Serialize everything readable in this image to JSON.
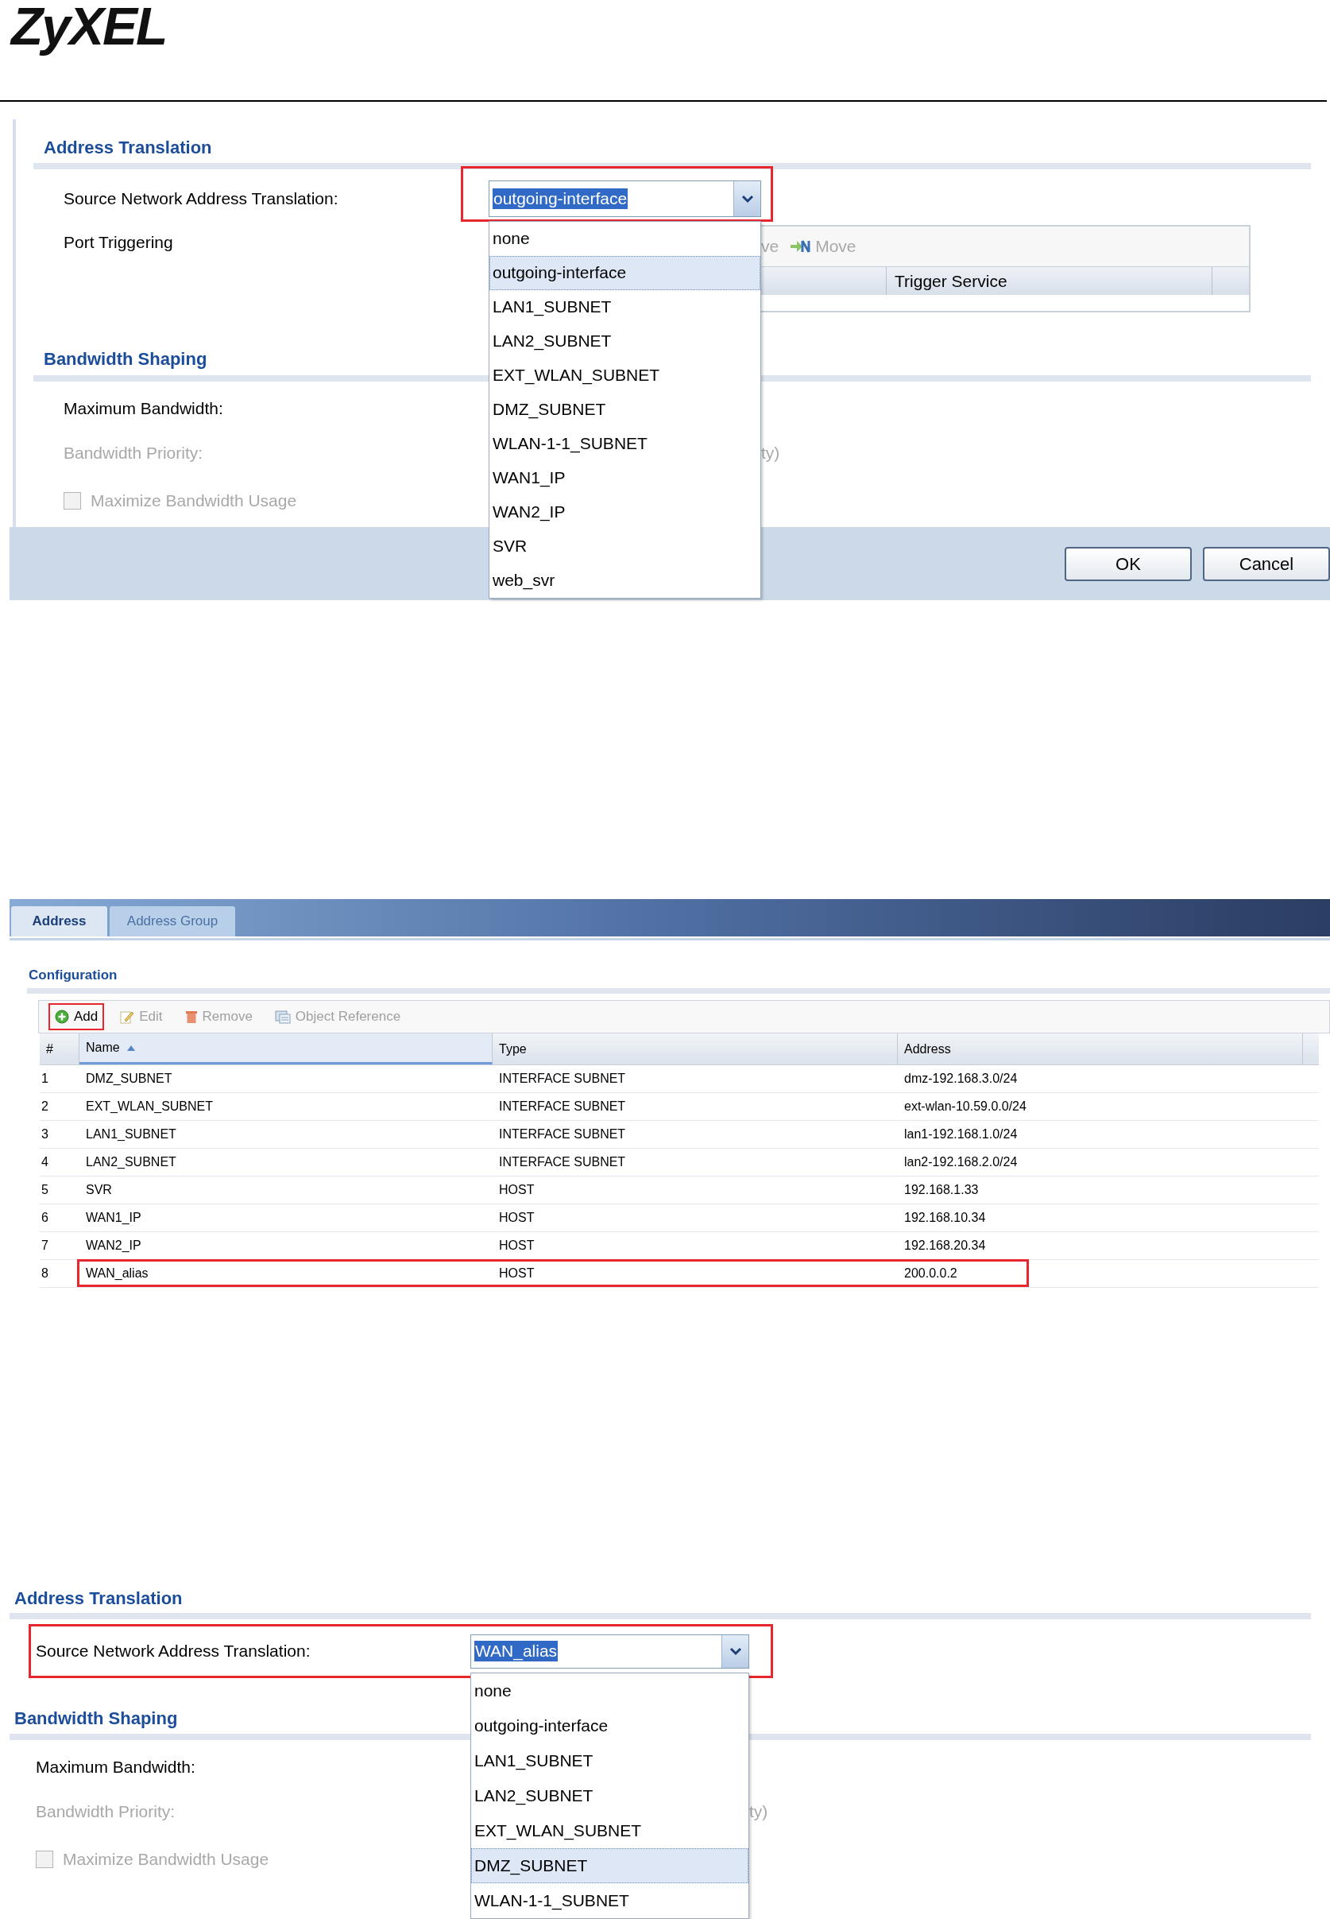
{
  "logo": {
    "text": "ZyXEL"
  },
  "panel_1": {
    "address_translation": {
      "title": "Address Translation",
      "snat_label": "Source Network Address Translation:",
      "snat_value": "outgoing-interface",
      "highlighted": true,
      "options": [
        {
          "label": "none",
          "selected": false
        },
        {
          "label": "outgoing-interface",
          "selected": true
        },
        {
          "label": "LAN1_SUBNET",
          "selected": false
        },
        {
          "label": "LAN2_SUBNET",
          "selected": false
        },
        {
          "label": "EXT_WLAN_SUBNET",
          "selected": false
        },
        {
          "label": "DMZ_SUBNET",
          "selected": false
        },
        {
          "label": "WLAN-1-1_SUBNET",
          "selected": false
        },
        {
          "label": "WAN1_IP",
          "selected": false
        },
        {
          "label": "WAN2_IP",
          "selected": false
        },
        {
          "label": "SVR",
          "selected": false
        },
        {
          "label": "web_svr",
          "selected": false
        }
      ]
    },
    "port_triggering": {
      "label": "Port Triggering",
      "toolbar_text": "ve",
      "move_button": "Move",
      "column": "Trigger Service"
    },
    "bandwidth_shaping": {
      "title": "Bandwidth Shaping",
      "maximum_bandwidth": "Maximum Bandwidth:",
      "bandwidth_priority": {
        "label": "Bandwidth Priority:",
        "disabled": true
      },
      "priority_tail": "ty)",
      "maximize": {
        "label": "Maximize Bandwidth Usage",
        "checked": false,
        "disabled": true
      }
    },
    "buttons": [
      "OK",
      "Cancel"
    ]
  },
  "address_panel": {
    "tabs": [
      {
        "label": "Address",
        "selected": true
      },
      {
        "label": "Address Group",
        "selected": false
      }
    ],
    "section_title": "Configuration",
    "toolbar": [
      {
        "kind": "add",
        "label": "Add",
        "disabled": false,
        "highlighted": true
      },
      {
        "kind": "edit",
        "label": "Edit",
        "disabled": true,
        "highlighted": false
      },
      {
        "kind": "remove",
        "label": "Remove",
        "disabled": true,
        "highlighted": false
      },
      {
        "kind": "reference",
        "label": "Object Reference",
        "disabled": true,
        "highlighted": false
      }
    ],
    "columns": [
      "#",
      "Name",
      "Type",
      "Address"
    ],
    "rows": [
      {
        "index": "1",
        "name": "DMZ_SUBNET",
        "type": "INTERFACE SUBNET",
        "address": "dmz-192.168.3.0/24",
        "highlighted": false
      },
      {
        "index": "2",
        "name": "EXT_WLAN_SUBNET",
        "type": "INTERFACE SUBNET",
        "address": "ext-wlan-10.59.0.0/24",
        "highlighted": false
      },
      {
        "index": "3",
        "name": "LAN1_SUBNET",
        "type": "INTERFACE SUBNET",
        "address": "lan1-192.168.1.0/24",
        "highlighted": false
      },
      {
        "index": "4",
        "name": "LAN2_SUBNET",
        "type": "INTERFACE SUBNET",
        "address": "lan2-192.168.2.0/24",
        "highlighted": false
      },
      {
        "index": "5",
        "name": "SVR",
        "type": "HOST",
        "address": "192.168.1.33",
        "highlighted": false
      },
      {
        "index": "6",
        "name": "WAN1_IP",
        "type": "HOST",
        "address": "192.168.10.34",
        "highlighted": false
      },
      {
        "index": "7",
        "name": "WAN2_IP",
        "type": "HOST",
        "address": "192.168.20.34",
        "highlighted": false
      },
      {
        "index": "8",
        "name": "WAN_alias",
        "type": "HOST",
        "address": "200.0.0.2",
        "highlighted": true
      }
    ]
  },
  "panel_3": {
    "address_translation": {
      "title": "Address Translation",
      "snat_label": "Source Network Address Translation:",
      "snat_value": "WAN_alias",
      "highlighted": true,
      "options": [
        {
          "label": "none",
          "selected": false
        },
        {
          "label": "outgoing-interface",
          "selected": false
        },
        {
          "label": "LAN1_SUBNET",
          "selected": false
        },
        {
          "label": "LAN2_SUBNET",
          "selected": false
        },
        {
          "label": "EXT_WLAN_SUBNET",
          "selected": false
        },
        {
          "label": "DMZ_SUBNET",
          "selected": true
        },
        {
          "label": "WLAN-1-1_SUBNET",
          "selected": false
        }
      ]
    },
    "bandwidth_shaping": {
      "title": "Bandwidth Shaping",
      "maximum_bandwidth": "Maximum Bandwidth:",
      "bandwidth_priority": {
        "label": "Bandwidth Priority:",
        "disabled": true
      },
      "priority_tail": "ty)",
      "maximize": {
        "label": "Maximize Bandwidth Usage",
        "checked": false,
        "disabled": true
      }
    }
  }
}
